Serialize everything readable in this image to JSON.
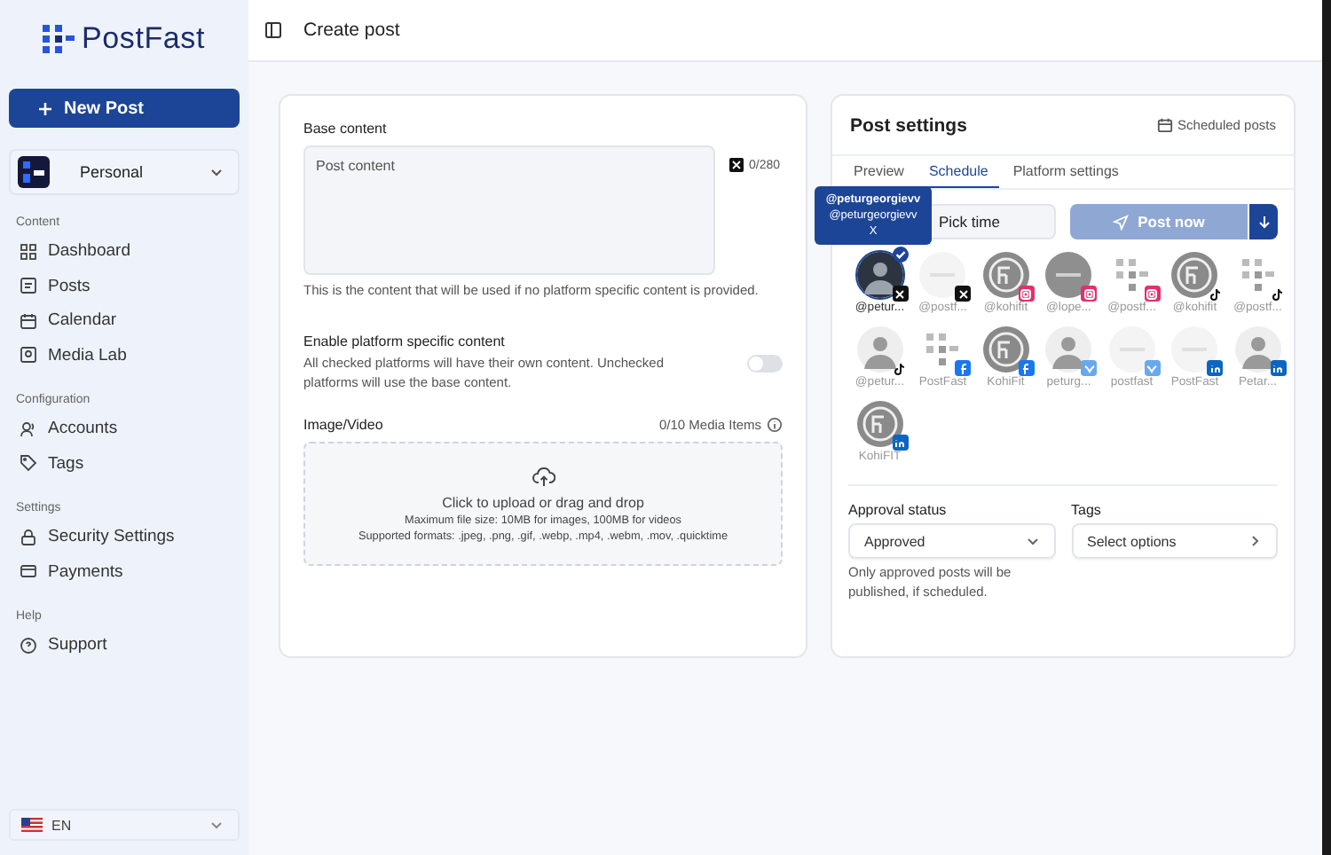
{
  "sidebar": {
    "logo": "PostFast",
    "new_post": "New Post",
    "workspace": "Personal",
    "sections": [
      {
        "title": "Content",
        "items": [
          "Dashboard",
          "Posts",
          "Calendar",
          "Media Lab"
        ]
      },
      {
        "title": "Configuration",
        "items": [
          "Accounts",
          "Tags"
        ]
      },
      {
        "title": "Settings",
        "items": [
          "Security Settings",
          "Payments"
        ]
      },
      {
        "title": "Help",
        "items": [
          "Support"
        ]
      }
    ],
    "language": "EN"
  },
  "header": {
    "title": "Create post"
  },
  "editor": {
    "base_label": "Base content",
    "placeholder": "Post content",
    "char_count": "0/280",
    "hint": "This is the content that will be used if no platform specific content is provided.",
    "platform_specific": {
      "label": "Enable platform specific content",
      "description": "All checked platforms will have their own content. Unchecked platforms will use the base content.",
      "on": false
    },
    "media_label": "Image/Video",
    "media_count": "0/10 Media Items",
    "upload_title": "Click to upload or drag and drop",
    "upload_size": "Maximum file size: 10MB for images, 100MB for videos",
    "upload_formats": "Supported formats: .jpeg, .png, .gif, .webp, .mp4, .webm, .mov, .quicktime"
  },
  "settings": {
    "title": "Post settings",
    "scheduled_link": "Scheduled posts",
    "tabs": [
      {
        "label": "Preview",
        "selected": false
      },
      {
        "label": "Schedule",
        "selected": true
      },
      {
        "label": "Platform settings",
        "selected": false
      }
    ],
    "time_placeholder": "Pick time",
    "post_now": "Post now",
    "tooltip": {
      "name": "@peturgeorgievv",
      "handle": "@peturgeorgievv",
      "platform": "X"
    },
    "accounts": [
      {
        "handle": "@petur...",
        "avatar": {
          "kind": "person-dark"
        },
        "kind": "x",
        "selected": true
      },
      {
        "handle": "@postf...",
        "avatar": {
          "kind": "blank"
        },
        "kind": "x",
        "selected": false
      },
      {
        "handle": "@kohifit",
        "avatar": {
          "kind": "ff"
        },
        "kind": "instagram",
        "selected": false
      },
      {
        "handle": "@lope...",
        "avatar": {
          "kind": "grey"
        },
        "kind": "instagram",
        "selected": false
      },
      {
        "handle": "@postf...",
        "avatar": {
          "kind": "pf"
        },
        "kind": "instagram",
        "selected": false
      },
      {
        "handle": "@kohifit",
        "avatar": {
          "kind": "ff"
        },
        "kind": "tiktok",
        "selected": false
      },
      {
        "handle": "@postf...",
        "avatar": {
          "kind": "pf"
        },
        "kind": "tiktok",
        "selected": false
      },
      {
        "handle": "@petur...",
        "avatar": {
          "kind": "person"
        },
        "kind": "tiktok",
        "selected": false
      },
      {
        "handle": "PostFast",
        "avatar": {
          "kind": "pf"
        },
        "kind": "facebook",
        "selected": false
      },
      {
        "handle": "KohiFit",
        "avatar": {
          "kind": "ff"
        },
        "kind": "facebook",
        "selected": false
      },
      {
        "handle": "peturg...",
        "avatar": {
          "kind": "person"
        },
        "kind": "bluesky",
        "selected": false
      },
      {
        "handle": "postfast",
        "avatar": {
          "kind": "blank"
        },
        "kind": "bluesky",
        "selected": false
      },
      {
        "handle": "PostFast",
        "avatar": {
          "kind": "blank"
        },
        "kind": "linkedin",
        "selected": false
      },
      {
        "handle": "Petar...",
        "avatar": {
          "kind": "person"
        },
        "kind": "linkedin",
        "selected": false
      },
      {
        "handle": "KohiFIT",
        "avatar": {
          "kind": "ff"
        },
        "kind": "linkedin",
        "selected": false
      }
    ],
    "approval_label": "Approval status",
    "approval_value": "Approved",
    "approval_hint": "Only approved posts will be published, if scheduled.",
    "tags_label": "Tags",
    "tags_placeholder": "Select options"
  }
}
